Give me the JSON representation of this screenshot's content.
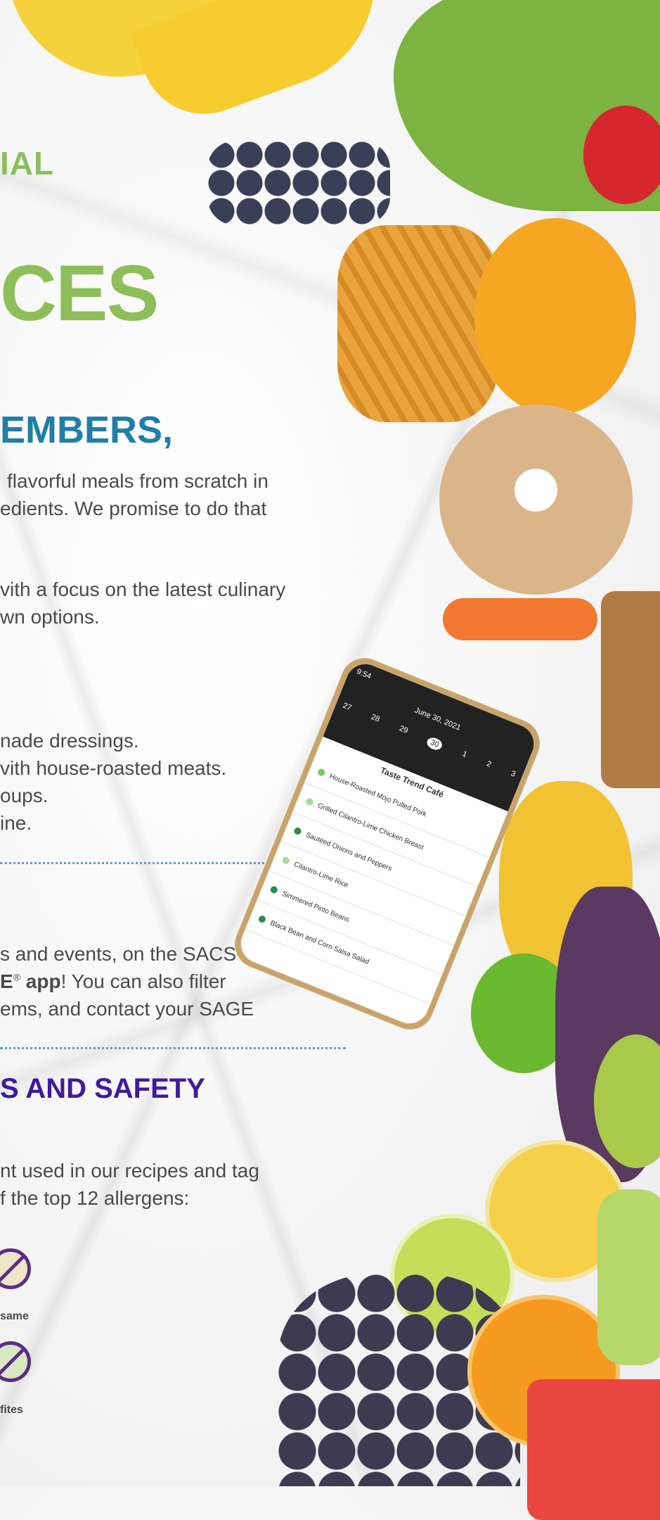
{
  "header": {
    "kicker": "IAL",
    "hero": "CES"
  },
  "members_section": {
    "title": "EMBERS,",
    "paragraph1": [
      "flavorful meals from scratch in",
      "edients. We promise to do that"
    ],
    "paragraph2": [
      "vith a focus on the latest culinary",
      "wn options."
    ],
    "list": [
      "nade dressings.",
      "vith house-roasted meats.",
      "oups.",
      "ine."
    ]
  },
  "app_section": {
    "line1": "s and events, on the SACS",
    "line2_bold": "E",
    "line2_reg_mark": "®",
    "line2_bold2": " app",
    "line2_rest": "! You can also filter",
    "line3": "ems, and contact your SAGE"
  },
  "safety_section": {
    "title": "S AND SAFETY",
    "line1": "nt used in our recipes and tag",
    "line2": "f the top 12 allergens:",
    "allergens": [
      {
        "label": "same",
        "icon": "no-sesame-icon"
      },
      {
        "label": "fites",
        "icon": "no-sulfites-icon"
      }
    ]
  },
  "phone": {
    "time": "9:54",
    "date": "June 30, 2021",
    "days": [
      "27",
      "28",
      "29",
      "30",
      "1",
      "2",
      "3"
    ],
    "brand": "Taste Trend Café",
    "menu_items": [
      "House-Roasted Mojo Pulled Pork",
      "Grilled Cilantro-Lime Chicken Breast",
      "Sautéed Onions and Peppers",
      "Cilantro-Lime Rice",
      "Simmered Pinto Beans",
      "Black Bean and Corn Salsa Salad"
    ]
  },
  "colors": {
    "green": "#8cbf58",
    "blue": "#1f7fa8",
    "purple": "#3f1aa0"
  }
}
